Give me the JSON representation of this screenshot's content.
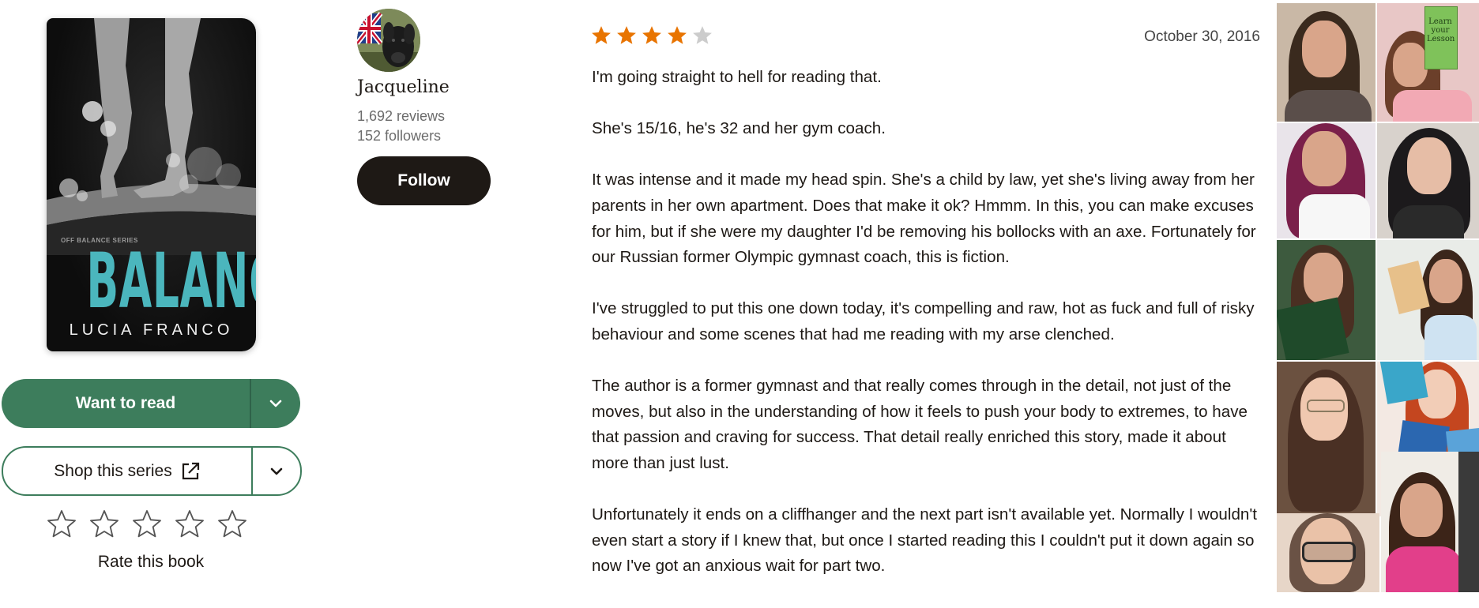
{
  "book": {
    "cover": {
      "series_text": "OFF BALANCE SERIES",
      "title": "BALANCE",
      "author": "LUCIA FRANCO"
    },
    "want_to_read_label": "Want to read",
    "shop_label": "Shop this series",
    "rate_label": "Rate this book",
    "rate_stars_total": 5
  },
  "reviewer": {
    "name": "Jacqueline",
    "reviews": "1,692 reviews",
    "followers": "152 followers",
    "follow_label": "Follow"
  },
  "review": {
    "rating": 4,
    "max_rating": 5,
    "date": "October 30, 2016",
    "paragraphs": [
      "I'm going straight to hell for reading that.",
      "She's 15/16, he's 32 and her gym coach.",
      "It was intense and it made my head spin. She's a child by law, yet she's living away from her parents in her own apartment. Does that make it ok? Hmmm. In this, you can make excuses for him, but if she were my daughter I'd be removing his bollocks with an axe. Fortunately for our Russian former Olympic gymnast coach, this is fiction.",
      "I've struggled to put this one down today, it's compelling and raw, hot as fuck and full of risky behaviour and some scenes that had me reading with my arse clenched.",
      "The author is a former gymnast and that really comes through in the detail, not just of the moves, but also in the understanding of how it feels to push your body to extremes, to have that passion and craving for success. That detail really enriched this story, made it about more than just lust.",
      "Unfortunately it ends on a cliffhanger and the next part isn't available yet. Normally I wouldn't even start a story if I knew that, but once I started reading this I couldn't put it down again so now I've got an anxious wait for part two."
    ]
  },
  "collage": {
    "book_in_photo_text": "Learn your Lesson"
  },
  "colors": {
    "brand_green": "#3d7d5c",
    "dark": "#1e1915",
    "star_orange": "#e87400",
    "star_empty": "#cccccc",
    "cover_title": "#4bb6bd"
  }
}
